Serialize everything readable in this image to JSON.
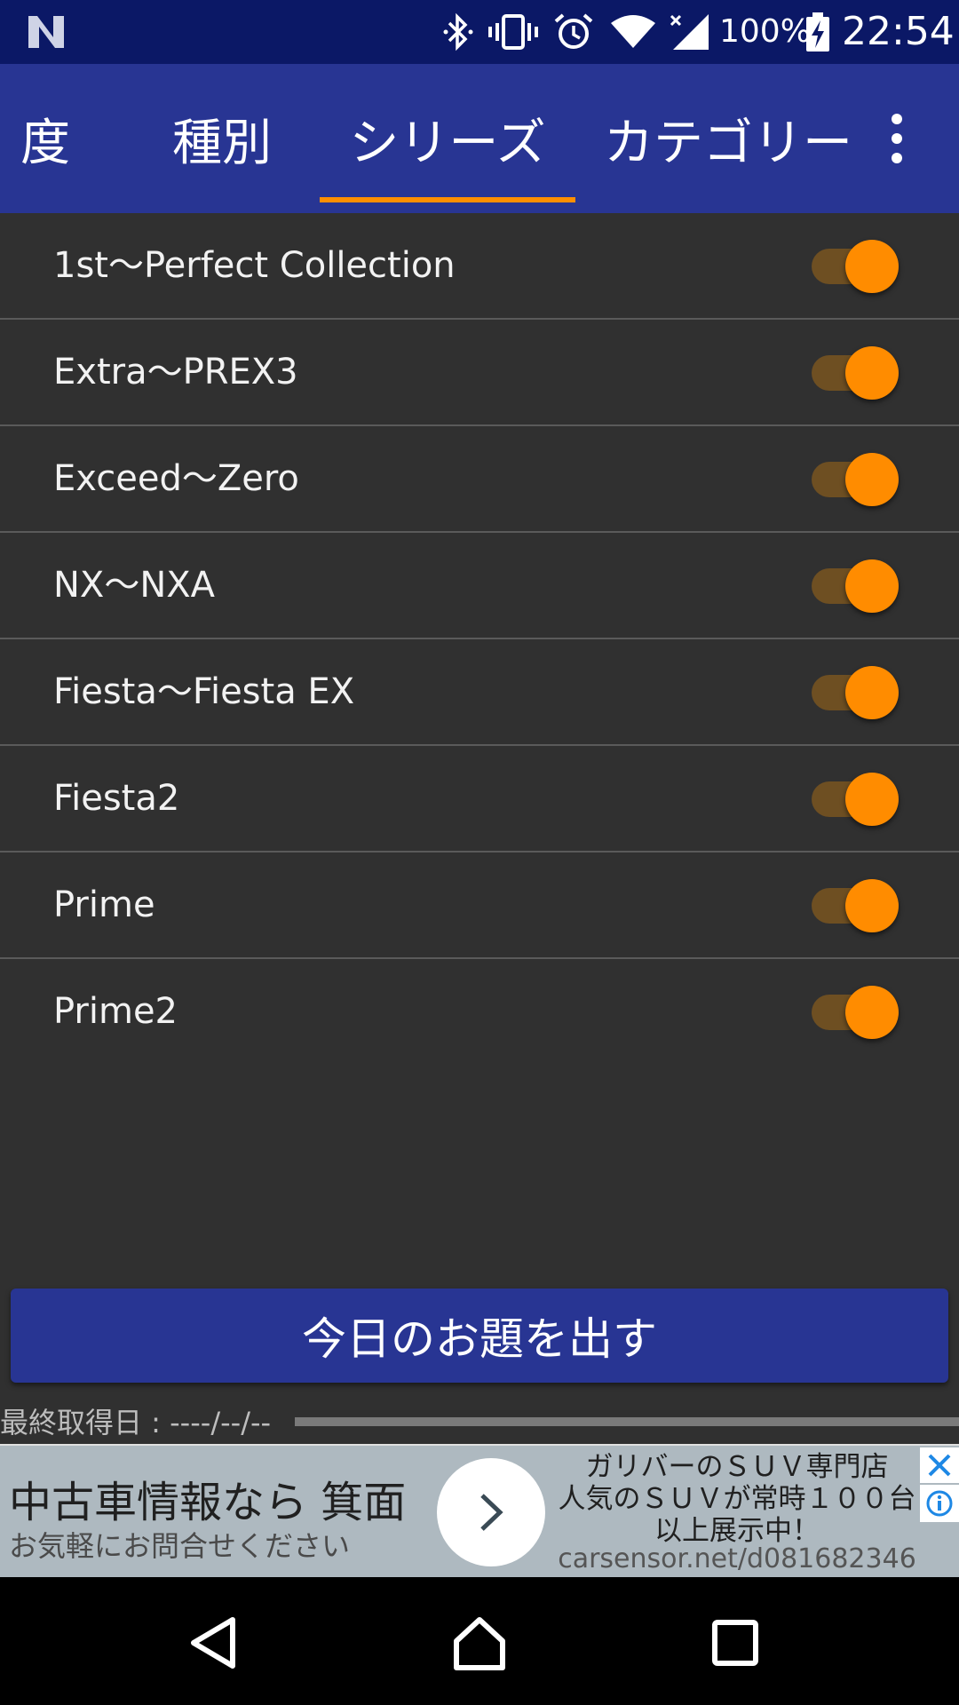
{
  "status_bar": {
    "battery_percent": "100%",
    "time": "22:54",
    "icons": [
      "n-logo-icon",
      "bluetooth-icon",
      "vibrate-icon",
      "alarm-icon",
      "wifi-icon",
      "signal-icon",
      "battery-charging-icon"
    ]
  },
  "tabs": [
    {
      "label": "度",
      "selected": false
    },
    {
      "label": "種別",
      "selected": false
    },
    {
      "label": "シリーズ",
      "selected": true
    },
    {
      "label": "カテゴリー",
      "selected": false
    }
  ],
  "overflow_menu": {
    "icon": "more-vert-icon"
  },
  "series": [
    {
      "label": "1st〜Perfect Collection",
      "enabled": true
    },
    {
      "label": "Extra〜PREX3",
      "enabled": true
    },
    {
      "label": "Exceed〜Zero",
      "enabled": true
    },
    {
      "label": "NX〜NXA",
      "enabled": true
    },
    {
      "label": "Fiesta〜Fiesta EX",
      "enabled": true
    },
    {
      "label": "Fiesta2",
      "enabled": true
    },
    {
      "label": "Prime",
      "enabled": true
    },
    {
      "label": "Prime2",
      "enabled": true
    }
  ],
  "main_button": {
    "label": "今日のお題を出す"
  },
  "last_fetch": {
    "text": "最終取得日 : ----/--/--"
  },
  "progress": {
    "value": 0
  },
  "ad": {
    "headline": "中古車情報なら 箕面",
    "subline": "お気軽にお問合せください",
    "promo_line1": "ガリバーのＳＵＶ専門店",
    "promo_line2": "人気のＳＵＶが常時１００台",
    "promo_line3": "以上展示中！",
    "url": "carsensor.net/d081682346"
  },
  "colors": {
    "status_bar": "#0b1866",
    "app_bar": "#283593",
    "accent": "#ff8c00",
    "background": "#303030"
  }
}
